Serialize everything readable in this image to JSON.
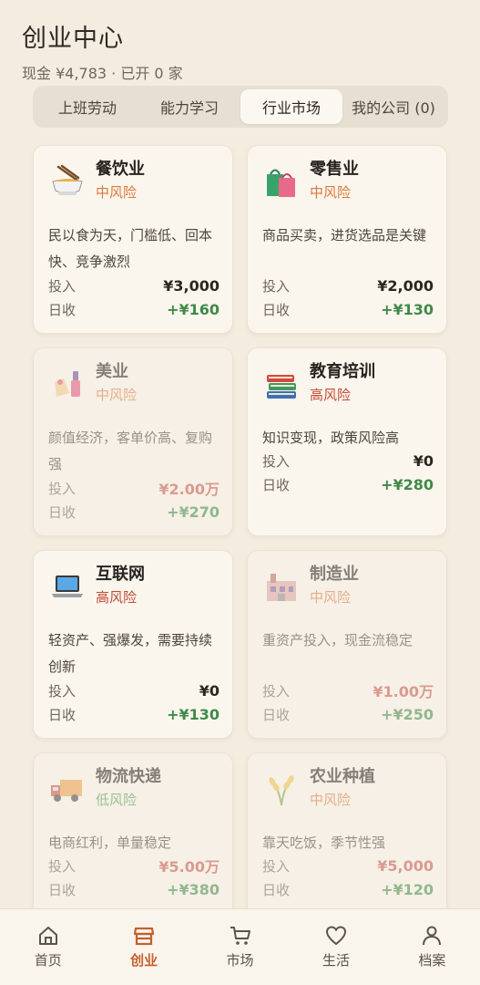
{
  "header": {
    "title": "创业中心",
    "subtitle": "现金 ¥4,783 · 已开 0 家"
  },
  "tabs": [
    {
      "label": "上班劳动",
      "active": false
    },
    {
      "label": "能力学习",
      "active": false
    },
    {
      "label": "行业市场",
      "active": true
    },
    {
      "label": "我的公司 (0)",
      "active": false
    }
  ],
  "colors": {
    "risk_mid": "#d9783c",
    "risk_high": "#c24a35",
    "risk_low": "#4f9a4c",
    "income": "#3f8a48",
    "invest_dim": "#c4554a",
    "accent": "#c4602c"
  },
  "industries": [
    {
      "icon": "noodle-bowl-icon",
      "name": "餐饮业",
      "risk": "中风险",
      "desc": "民以食为天，门槛低、回本快、竞争激烈",
      "invest_label": "投入",
      "invest": "¥3,000",
      "daily_label": "日收",
      "daily": "+¥160"
    },
    {
      "icon": "shopping-bags-icon",
      "name": "零售业",
      "risk": "中风险",
      "desc": "商品买卖，进货选品是关键",
      "invest_label": "投入",
      "invest": "¥2,000",
      "daily_label": "日收",
      "daily": "+¥130"
    },
    {
      "icon": "nail-polish-icon",
      "name": "美业",
      "risk": "中风险",
      "desc": "颜值经济，客单价高、复购强",
      "invest_label": "投入",
      "invest": "¥2.00万",
      "daily_label": "日收",
      "daily": "+¥270"
    },
    {
      "icon": "books-icon",
      "name": "教育培训",
      "risk": "高风险",
      "desc": "知识变现，政策风险高",
      "invest_label": "投入",
      "invest": "¥0",
      "daily_label": "日收",
      "daily": "+¥280"
    },
    {
      "icon": "laptop-icon",
      "name": "互联网",
      "risk": "高风险",
      "desc": "轻资产、强爆发，需要持续创新",
      "invest_label": "投入",
      "invest": "¥0",
      "daily_label": "日收",
      "daily": "+¥130"
    },
    {
      "icon": "factory-icon",
      "name": "制造业",
      "risk": "中风险",
      "desc": "重资产投入，现金流稳定",
      "invest_label": "投入",
      "invest": "¥1.00万",
      "daily_label": "日收",
      "daily": "+¥250"
    },
    {
      "icon": "delivery-truck-icon",
      "name": "物流快递",
      "risk": "低风险",
      "desc": "电商红利，单量稳定",
      "invest_label": "投入",
      "invest": "¥5.00万",
      "daily_label": "日收",
      "daily": "+¥380"
    },
    {
      "icon": "rice-plant-icon",
      "name": "农业种植",
      "risk": "中风险",
      "desc": "靠天吃饭，季节性强",
      "invest_label": "投入",
      "invest": "¥5,000",
      "daily_label": "日收",
      "daily": "+¥120"
    }
  ],
  "nav": [
    {
      "icon": "home-icon",
      "label": "首页",
      "active": false
    },
    {
      "icon": "shop-icon",
      "label": "创业",
      "active": true
    },
    {
      "icon": "cart-icon",
      "label": "市场",
      "active": false
    },
    {
      "icon": "heart-icon",
      "label": "生活",
      "active": false
    },
    {
      "icon": "user-icon",
      "label": "档案",
      "active": false
    }
  ]
}
